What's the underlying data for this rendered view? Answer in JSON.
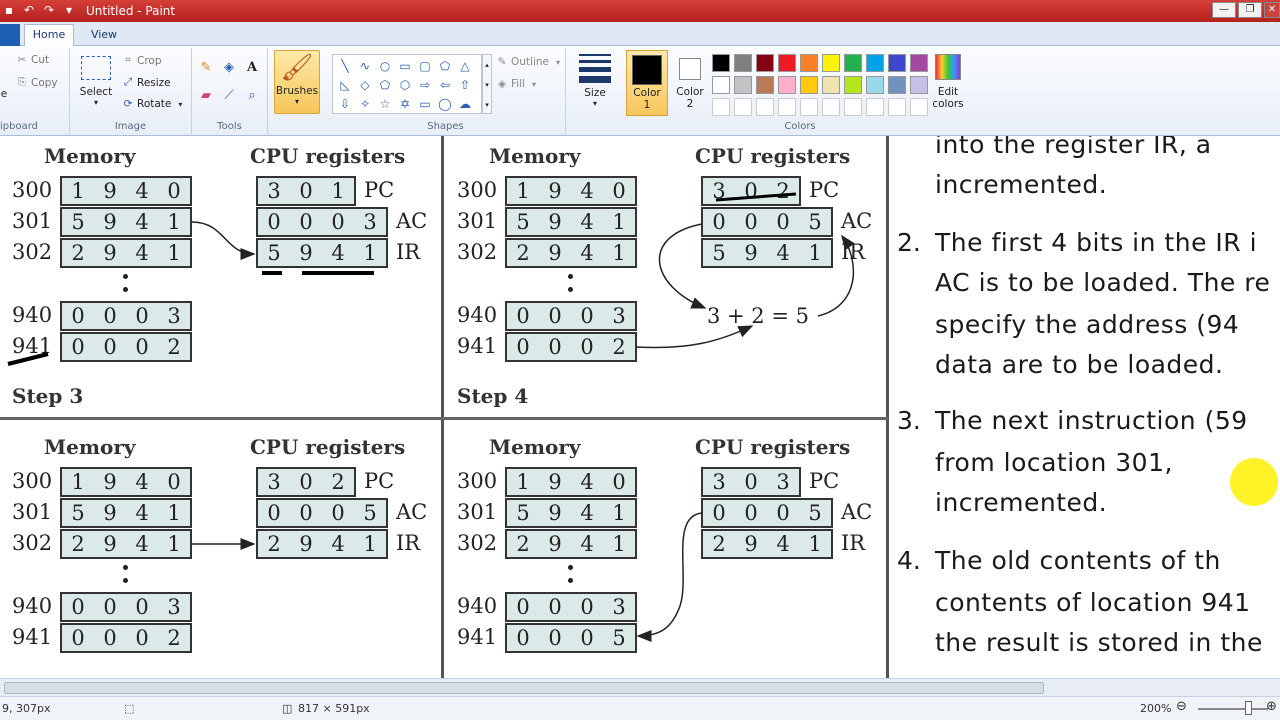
{
  "window": {
    "title": "Untitled - Paint",
    "minimize_glyph": "—",
    "restore_glyph": "❐",
    "close_glyph": "✕"
  },
  "tabs": {
    "home": "Home",
    "view": "View"
  },
  "ribbon": {
    "clipboard": {
      "label": "Clipboard",
      "paste_fragment": "e",
      "cut": "Cut",
      "copy": "Copy",
      "label_visible": "ipboard"
    },
    "image": {
      "label": "Image",
      "select": "Select",
      "crop": "Crop",
      "resize": "Resize",
      "rotate": "Rotate"
    },
    "tools": {
      "label": "Tools"
    },
    "brushes": {
      "label": "Brushes"
    },
    "shapes": {
      "label": "Shapes",
      "outline": "Outline",
      "fill": "Fill"
    },
    "size": {
      "label": "Size"
    },
    "colors": {
      "label": "Colors",
      "color1": "Color\n1",
      "color1_line1": "Color",
      "color1_line2": "1",
      "color2_line1": "Color",
      "color2_line2": "2",
      "edit_line1": "Edit",
      "edit_line2": "colors",
      "row1": [
        "#000000",
        "#7f7f7f",
        "#880015",
        "#ed1c24",
        "#ff7f27",
        "#fff200",
        "#22b14c",
        "#00a2e8",
        "#3f48cc",
        "#a349a4"
      ],
      "row2": [
        "#ffffff",
        "#c3c3c3",
        "#b97a57",
        "#ffaec9",
        "#ffc90e",
        "#efe4b0",
        "#b5e61d",
        "#99d9ea",
        "#7092be",
        "#c8bfe7"
      ]
    }
  },
  "canvas": {
    "panels": [
      {
        "memory_header": "Memory",
        "cpu_header": "CPU registers",
        "step": "Step 3",
        "mem": [
          [
            "300",
            "1",
            "9",
            "4",
            "0"
          ],
          [
            "301",
            "5",
            "9",
            "4",
            "1"
          ],
          [
            "302",
            "2",
            "9",
            "4",
            "1"
          ],
          [
            "940",
            "0",
            "0",
            "0",
            "3"
          ],
          [
            "941",
            "0",
            "0",
            "0",
            "2"
          ]
        ],
        "regs": [
          [
            "3",
            "0",
            "1",
            "PC"
          ],
          [
            "0",
            "0",
            "0",
            "3",
            "AC"
          ],
          [
            "5",
            "9",
            "4",
            "1",
            "IR"
          ]
        ]
      },
      {
        "memory_header": "Memory",
        "cpu_header": "CPU registers",
        "step": "Step 4",
        "mem": [
          [
            "300",
            "1",
            "9",
            "4",
            "0"
          ],
          [
            "301",
            "5",
            "9",
            "4",
            "1"
          ],
          [
            "302",
            "2",
            "9",
            "4",
            "1"
          ],
          [
            "940",
            "0",
            "0",
            "0",
            "3"
          ],
          [
            "941",
            "0",
            "0",
            "0",
            "2"
          ]
        ],
        "regs": [
          [
            "3",
            "0",
            "2",
            "PC"
          ],
          [
            "0",
            "0",
            "0",
            "5",
            "AC"
          ],
          [
            "5",
            "9",
            "4",
            "1",
            "IR"
          ]
        ],
        "equation": "3 + 2 = 5"
      },
      {
        "memory_header": "Memory",
        "cpu_header": "CPU registers",
        "step": "",
        "mem": [
          [
            "300",
            "1",
            "9",
            "4",
            "0"
          ],
          [
            "301",
            "5",
            "9",
            "4",
            "1"
          ],
          [
            "302",
            "2",
            "9",
            "4",
            "1"
          ],
          [
            "940",
            "0",
            "0",
            "0",
            "3"
          ],
          [
            "941",
            "0",
            "0",
            "0",
            "2"
          ]
        ],
        "regs": [
          [
            "3",
            "0",
            "2",
            "PC"
          ],
          [
            "0",
            "0",
            "0",
            "5",
            "AC"
          ],
          [
            "2",
            "9",
            "4",
            "1",
            "IR"
          ]
        ]
      },
      {
        "memory_header": "Memory",
        "cpu_header": "CPU registers",
        "step": "",
        "mem": [
          [
            "300",
            "1",
            "9",
            "4",
            "0"
          ],
          [
            "301",
            "5",
            "9",
            "4",
            "1"
          ],
          [
            "302",
            "2",
            "9",
            "4",
            "1"
          ],
          [
            "940",
            "0",
            "0",
            "0",
            "3"
          ],
          [
            "941",
            "0",
            "0",
            "0",
            "5"
          ]
        ],
        "regs": [
          [
            "3",
            "0",
            "3",
            "PC"
          ],
          [
            "0",
            "0",
            "0",
            "5",
            "AC"
          ],
          [
            "2",
            "9",
            "4",
            "1",
            "IR"
          ]
        ]
      }
    ],
    "text_lines": [
      "into the register IR, a",
      "incremented.",
      "The first 4 bits in the IR i",
      "AC is to be loaded. The re",
      "specify the address (94",
      "data are to be loaded.",
      "The next instruction (59",
      "from location 301,",
      "incremented.",
      "The old contents of th",
      "contents of location 941",
      "the result is stored in the"
    ],
    "numbers": [
      "2.",
      "3.",
      "4."
    ]
  },
  "status": {
    "cursor_pos": "9, 307px",
    "canvas_size": "817 × 591px",
    "zoom": "200%",
    "zoom_out": "⊖",
    "zoom_in": "⊕"
  }
}
